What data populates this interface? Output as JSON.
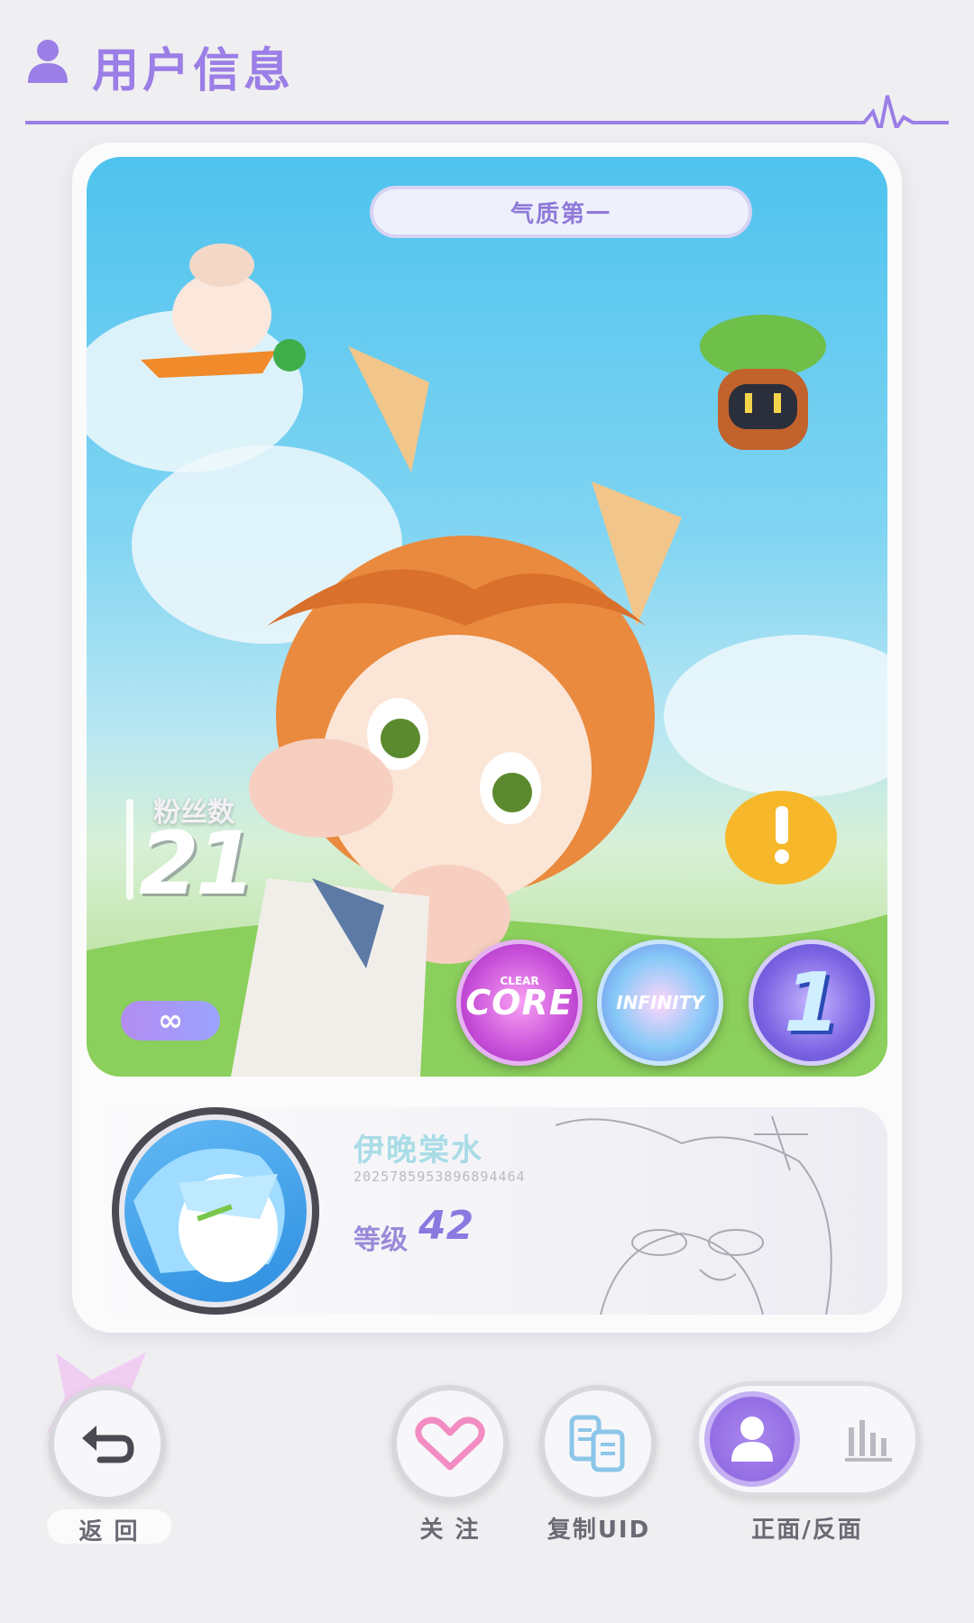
{
  "header": {
    "title": "用户信息"
  },
  "card": {
    "title_badge": "气质第一",
    "fans": {
      "label": "粉丝数",
      "count": "21"
    },
    "infinity_badge": "∞",
    "badges": [
      {
        "small": "CLEAR",
        "big": "CORE"
      },
      {
        "big": "INFINITY"
      },
      {
        "big": "1"
      }
    ]
  },
  "profile": {
    "username": "伊晚棠水",
    "uid": "2025785953896894464",
    "level_label": "等级",
    "level": "42"
  },
  "buttons": {
    "back": "返 回",
    "follow": "关 注",
    "copy_uid": "复制UID",
    "flip": "正面/反面"
  },
  "colors": {
    "accent": "#9b7ee6",
    "background": "#efeff1"
  }
}
